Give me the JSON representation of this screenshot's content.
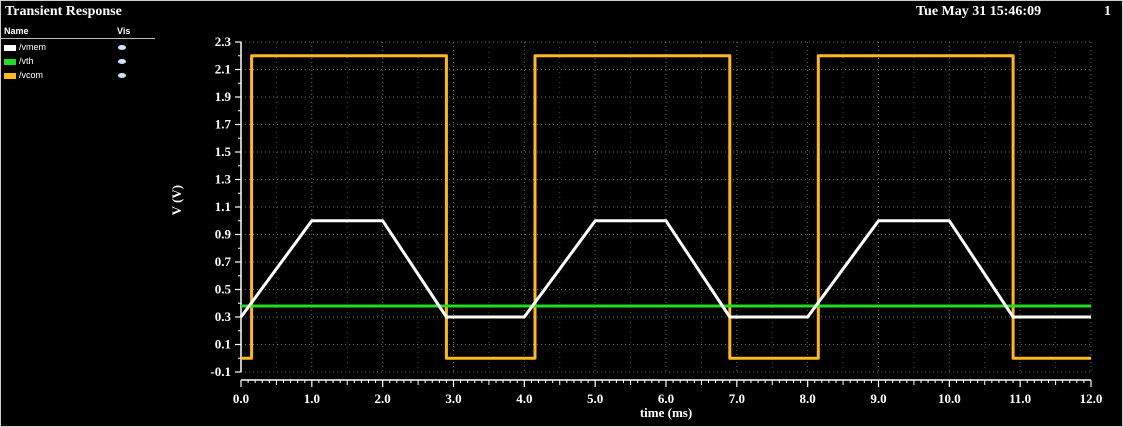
{
  "header": {
    "title": "Transient Response",
    "datetime": "Tue May 31 15:46:09",
    "page": "1"
  },
  "legend": {
    "col_name": "Name",
    "col_vis": "Vis",
    "items": [
      {
        "label": "/vmem",
        "color": "#ffffff"
      },
      {
        "label": "/vth",
        "color": "#22dd22"
      },
      {
        "label": "/vcom",
        "color": "#ffb81e"
      }
    ]
  },
  "chart_data": {
    "type": "line",
    "title": "Transient Response",
    "xlabel": "time (ms)",
    "ylabel": "V (V)",
    "xlim": [
      0,
      12
    ],
    "ylim": [
      -0.1,
      2.3
    ],
    "xticks": [
      "0.0",
      "1.0",
      "2.0",
      "3.0",
      "4.0",
      "5.0",
      "6.0",
      "7.0",
      "8.0",
      "9.0",
      "10.0",
      "11.0",
      "12.0"
    ],
    "yticks": [
      "2.3",
      "2.1",
      "1.9",
      "1.7",
      "1.5",
      "1.3",
      "1.1",
      "0.9",
      "0.7",
      "0.5",
      "0.3",
      "0.1",
      "-0.1"
    ],
    "grid": true,
    "series": [
      {
        "name": "/vmem",
        "color": "#ffffff",
        "x": [
          0,
          1.0,
          2.0,
          2.9,
          3.9,
          4.0,
          5.0,
          6.0,
          6.9,
          7.9,
          8.0,
          9.0,
          10.0,
          10.9,
          12.0
        ],
        "y": [
          0.3,
          1.0,
          1.0,
          0.3,
          0.3,
          0.3,
          1.0,
          1.0,
          0.3,
          0.3,
          0.3,
          1.0,
          1.0,
          0.3,
          0.3
        ]
      },
      {
        "name": "/vth",
        "color": "#22dd22",
        "x": [
          0,
          12.0
        ],
        "y": [
          0.38,
          0.38
        ]
      },
      {
        "name": "/vcom",
        "color": "#ffb81e",
        "x": [
          0,
          0.15,
          0.15,
          2.9,
          2.9,
          4.15,
          4.15,
          6.9,
          6.9,
          8.15,
          8.15,
          10.9,
          10.9,
          12.0
        ],
        "y": [
          0.0,
          0.0,
          2.2,
          2.2,
          0.0,
          0.0,
          2.2,
          2.2,
          0.0,
          0.0,
          2.2,
          2.2,
          0.0,
          0.0
        ]
      }
    ]
  }
}
